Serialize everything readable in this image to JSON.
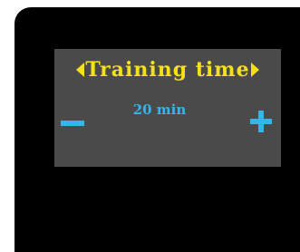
{
  "screen": {
    "title": "Training time",
    "value": "20 min",
    "icons": {
      "prev": "left-arrow-icon",
      "next": "right-arrow-icon",
      "decrease": "minus-icon",
      "increase": "plus-icon"
    }
  },
  "colors": {
    "title": "#f5e11a",
    "value": "#34b6e8",
    "screen_bg": "#4a4a4a",
    "device_bg": "#000000"
  }
}
